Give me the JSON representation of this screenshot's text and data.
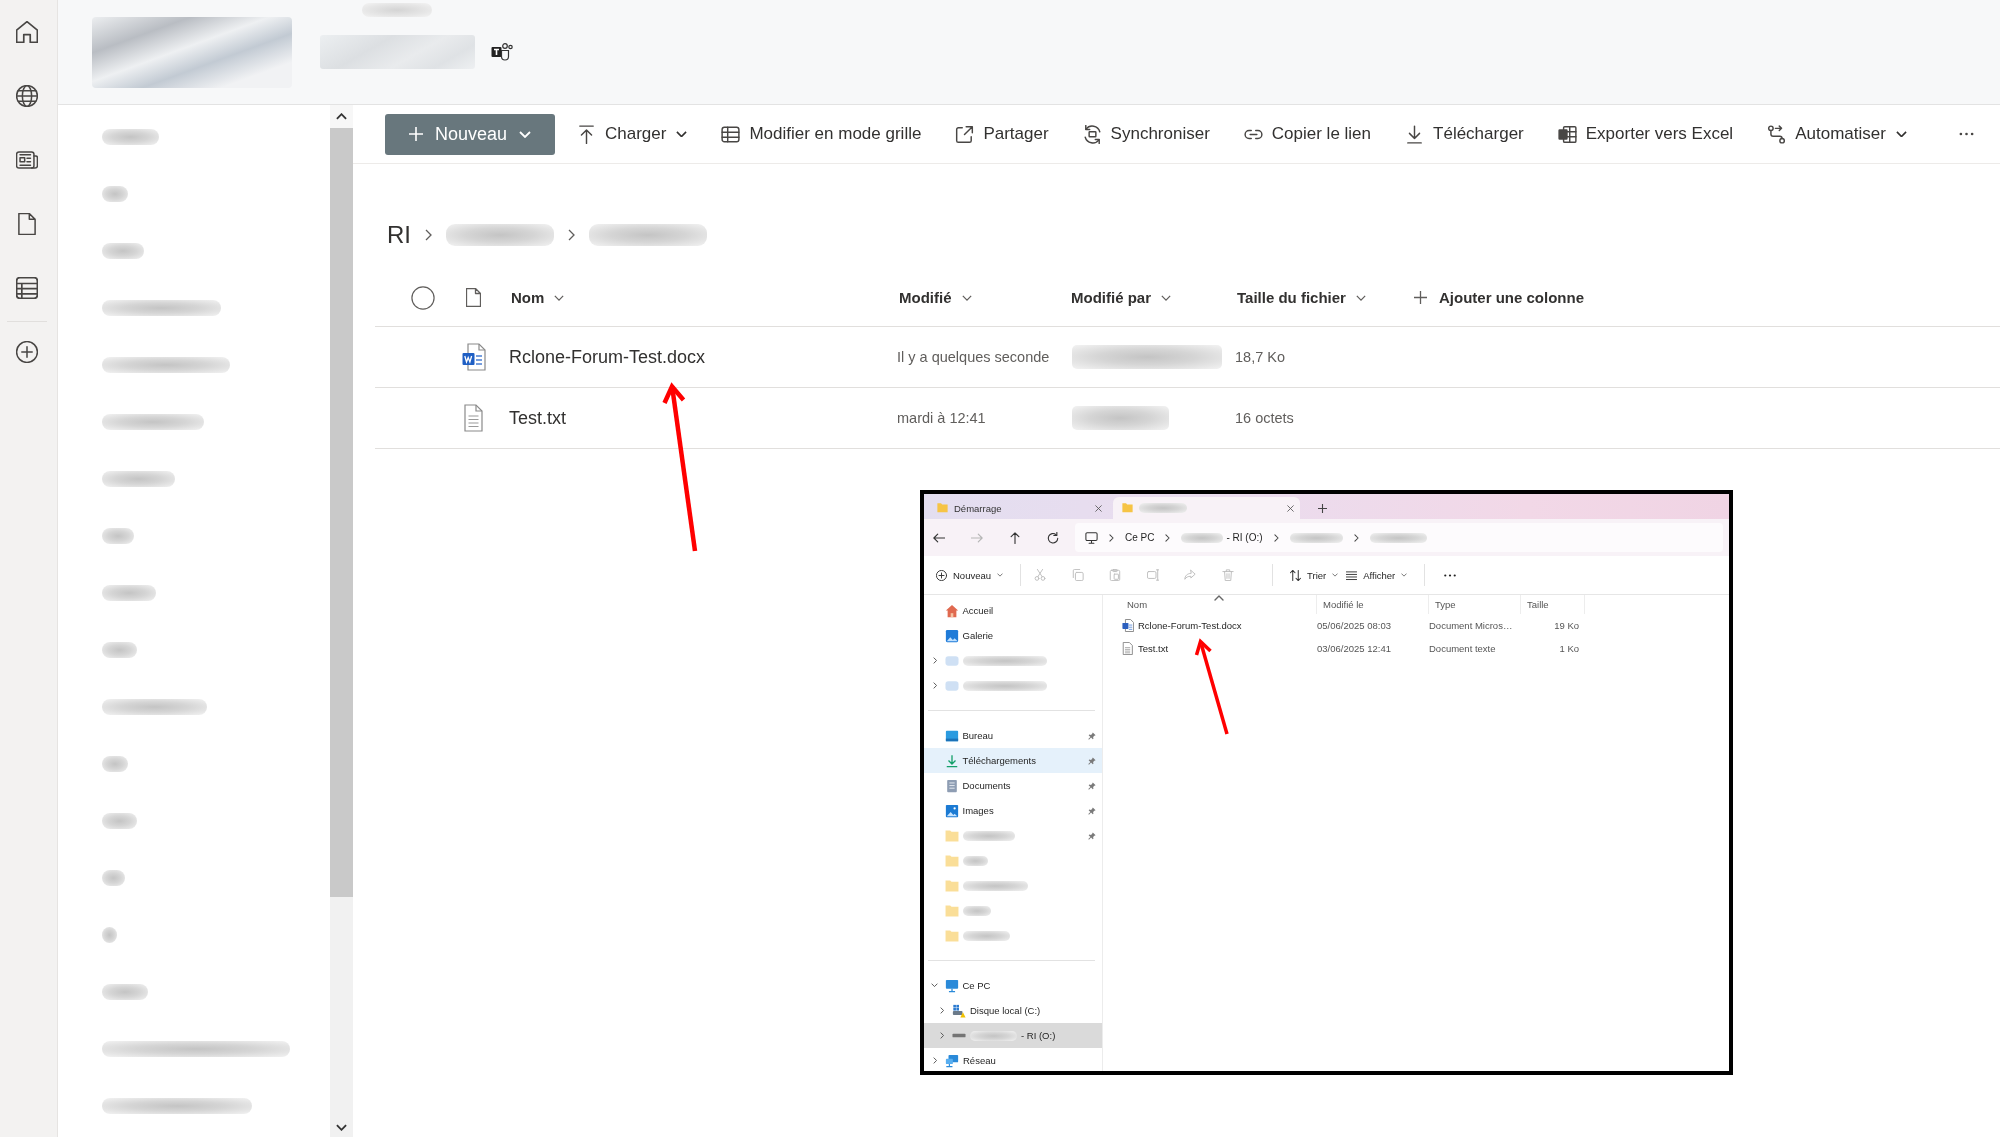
{
  "command_bar": {
    "new_button": {
      "label": "Nouveau",
      "menu": true
    },
    "actions": [
      {
        "label": "Charger",
        "menu": true
      },
      {
        "label": "Modifier en mode grille",
        "menu": false
      },
      {
        "label": "Partager",
        "menu": false
      },
      {
        "label": "Synchroniser",
        "menu": false
      },
      {
        "label": "Copier le lien",
        "menu": false
      },
      {
        "label": "Télécharger",
        "menu": false
      },
      {
        "label": "Exporter vers Excel",
        "menu": false
      },
      {
        "label": "Automatiser",
        "menu": true
      }
    ]
  },
  "sidebar": {
    "items": [
      {
        "redacted": true
      },
      {
        "redacted": true
      },
      {
        "redacted": true
      },
      {
        "redacted": true
      },
      {
        "redacted": true
      },
      {
        "redacted": true
      },
      {
        "redacted": true
      },
      {
        "redacted": true
      },
      {
        "redacted": true
      },
      {
        "redacted": true
      },
      {
        "redacted": true
      },
      {
        "redacted": true
      },
      {
        "redacted": true
      },
      {
        "redacted": true
      },
      {
        "redacted": true
      },
      {
        "redacted": true
      },
      {
        "redacted": true
      },
      {
        "redacted": true
      }
    ]
  },
  "breadcrumb": {
    "items": [
      {
        "label": "RI",
        "redacted": false
      },
      {
        "redacted": true
      },
      {
        "redacted": true
      }
    ]
  },
  "file_list": {
    "select_all": {
      "selected": false
    },
    "columns": [
      {
        "kind": "sort",
        "label": "Nom"
      },
      {
        "kind": "sort",
        "label": "Modifié"
      },
      {
        "kind": "sort",
        "label": "Modifié par"
      },
      {
        "kind": "sort",
        "label": "Taille du fichier"
      },
      {
        "kind": "add",
        "label": "Ajouter une colonne"
      }
    ],
    "rows": [
      {
        "kind": "word",
        "name": "Rclone-Forum-Test.docx",
        "modified": "Il y a quelques seconde",
        "modified_by": {
          "redacted": true
        },
        "size": "18,7 Ko",
        "selected": false
      },
      {
        "kind": "text",
        "name": "Test.txt",
        "modified": "mardi à 12:41",
        "modified_by": {
          "redacted": true
        },
        "size": "16 octets",
        "selected": false
      }
    ]
  },
  "explorer_screenshot": {
    "tabs": [
      {
        "title": "Démarrage",
        "redacted": false,
        "selected": false
      },
      {
        "redacted": true,
        "selected": true
      }
    ],
    "nav_buttons": [
      {
        "disabled": false
      },
      {
        "disabled": true
      },
      {
        "disabled": false
      },
      {
        "disabled": false
      }
    ],
    "address": [
      {
        "label": "Ce PC",
        "redacted": false
      },
      {
        "label": "- RI (O:)",
        "redacted": true
      },
      {
        "redacted": true
      },
      {
        "redacted": true
      }
    ],
    "toolbar": {
      "new_label": "Nouveau",
      "icon_actions": [
        {
          "disabled": true
        },
        {
          "disabled": true
        },
        {
          "disabled": true
        },
        {
          "disabled": true
        },
        {
          "disabled": true
        },
        {
          "disabled": true
        }
      ],
      "sort_label": "Trier",
      "view_label": "Afficher"
    },
    "nav": [
      {
        "items": [
          {
            "kind": "home",
            "label": "Accueil",
            "redacted": false,
            "selected": false,
            "hovered": false,
            "pinned": false
          },
          {
            "kind": "gallery",
            "label": "Galerie",
            "redacted": false,
            "selected": false,
            "hovered": false,
            "pinned": false
          },
          {
            "kind": "cloud",
            "redacted": true,
            "expanded": false,
            "selected": false,
            "hovered": false,
            "pinned": false
          },
          {
            "kind": "cloud",
            "redacted": true,
            "expanded": false,
            "selected": false,
            "hovered": false,
            "pinned": false
          }
        ]
      },
      {
        "items": [
          {
            "kind": "desktop",
            "label": "Bureau",
            "redacted": false,
            "selected": false,
            "hovered": false,
            "pinned": true
          },
          {
            "kind": "downloads",
            "label": "Téléchargements",
            "redacted": false,
            "selected": false,
            "hovered": true,
            "pinned": true
          },
          {
            "kind": "documents",
            "label": "Documents",
            "redacted": false,
            "selected": false,
            "hovered": false,
            "pinned": true
          },
          {
            "kind": "pictures",
            "label": "Images",
            "redacted": false,
            "selected": false,
            "hovered": false,
            "pinned": true
          },
          {
            "kind": "folder",
            "redacted": true,
            "selected": false,
            "hovered": false,
            "pinned": true
          },
          {
            "kind": "folder",
            "redacted": true,
            "selected": false,
            "hovered": false,
            "pinned": false
          },
          {
            "kind": "folder",
            "redacted": true,
            "selected": false,
            "hovered": false,
            "pinned": false
          },
          {
            "kind": "folder",
            "redacted": true,
            "selected": false,
            "hovered": false,
            "pinned": false
          },
          {
            "kind": "folder",
            "redacted": true,
            "selected": false,
            "hovered": false,
            "pinned": false
          }
        ]
      },
      {
        "items": [
          {
            "kind": "pc",
            "label": "Ce PC",
            "redacted": false,
            "expanded": true,
            "selected": false,
            "hovered": false,
            "pinned": false,
            "children": [
              {
                "kind": "drive",
                "label": "Disque local (C:)",
                "redacted": false,
                "expanded": false,
                "selected": false,
                "hovered": false,
                "pinned": false
              },
              {
                "kind": "network_drive",
                "label": "- RI (O:)",
                "redacted": true,
                "expanded": false,
                "selected": true,
                "hovered": false,
                "pinned": false
              }
            ]
          },
          {
            "kind": "network",
            "label": "Réseau",
            "redacted": false,
            "expanded": false,
            "selected": false,
            "hovered": false,
            "pinned": false
          }
        ]
      }
    ],
    "columns": [
      {
        "label": "Nom",
        "sorted": true
      },
      {
        "label": "Modifié le",
        "sorted": false
      },
      {
        "label": "Type",
        "sorted": false
      },
      {
        "label": "Taille",
        "sorted": false
      }
    ],
    "files": [
      {
        "kind": "word",
        "name": "Rclone-Forum-Test.docx",
        "modified": "05/06/2025 08:03",
        "type": "Document Micros…",
        "size": "19 Ko"
      },
      {
        "kind": "text",
        "name": "Test.txt",
        "modified": "03/06/2025 12:41",
        "type": "Document texte",
        "size": "1 Ko"
      }
    ]
  }
}
